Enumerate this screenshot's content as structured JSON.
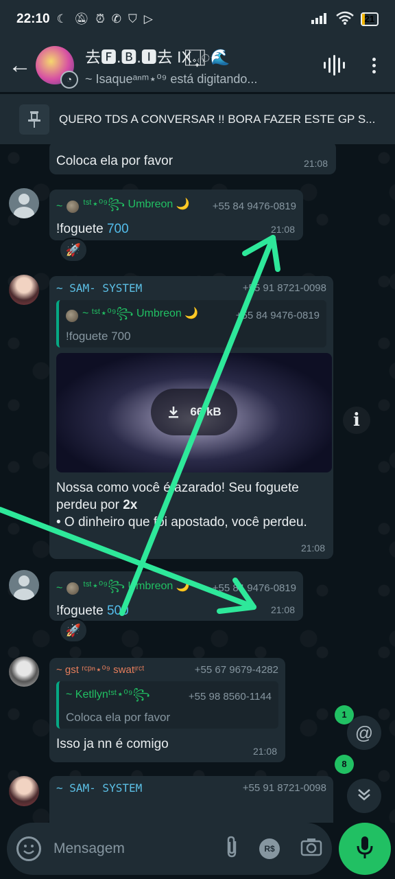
{
  "status_bar": {
    "time": "22:10",
    "icons": [
      "moon-icon",
      "bell-off-icon",
      "alarm-icon",
      "whatsapp-icon",
      "shield-icon",
      "play-icon"
    ],
    "battery": "21"
  },
  "header": {
    "title": "去🅵.🅱.🅸去 IX᩠𝆹⃞ ⃞᪾᮫🌊",
    "subtitle": "~ Isaqueᵃⁿᵐ⋆⁰⁹ está digitando..."
  },
  "pinned": {
    "text": "QUERO TDS A CONVERSAR !! BORA FAZER ESTE GP S..."
  },
  "messages": [
    {
      "text": "Coloca ela por favor",
      "time": "21:08"
    },
    {
      "sender_prefix": "~",
      "sender_name": "ᵗˢᵗ⋆⁰⁹꧂ Umbreon 🌙",
      "phone": "+55 84 9476-0819",
      "text_prefix": "!foguete ",
      "text_num": "700",
      "time": "21:08",
      "reaction": "🚀"
    },
    {
      "sender_name": "~ SAM- SYSTEM",
      "phone": "+55 91 8721-0098",
      "quote_name": "~ ᵗˢᵗ⋆⁰⁹꧂ Umbreon 🌙",
      "quote_phone": "+55 84 9476-0819",
      "quote_text": "!foguete 700",
      "media_size": "66 kB",
      "text_line1": "Nossa como você é azarado! Seu foguete",
      "text_line2_prefix": "perdeu por ",
      "text_line2_bold": "2x",
      "text_line3": "• O dinheiro que foi apostado, você perdeu.",
      "time": "21:08"
    },
    {
      "sender_prefix": "~",
      "sender_name": "ᵗˢᵗ⋆⁰⁹꧂ Umbreon 🌙",
      "phone": "+55 84 9476-0819",
      "text_prefix": "!foguete ",
      "text_num": "500",
      "time": "21:08",
      "reaction": "🚀"
    },
    {
      "sender_name": "~ gst ʳᶜᵖⁿ⋆⁰⁹ swatᵎʳᶜᵗ",
      "phone": "+55 67 9679-4282",
      "quote_name": "~ Ketllynᵗˢᵗ⋆⁰⁹꧂",
      "quote_phone": "+55 98 8560-1144",
      "quote_text": "Coloca ela por favor",
      "text": "Isso ja nn é comigo",
      "time": "21:08"
    },
    {
      "sender_name": "~ SAM- SYSTEM",
      "phone": "+55 91 8721-0098"
    }
  ],
  "floating": {
    "mention_badge": "1",
    "scroll_badge": "8"
  },
  "input": {
    "placeholder": "Mensagem",
    "pay_label": "R$"
  },
  "colors": {
    "accent": "#21c063",
    "annotation_arrows": "#2ee89a"
  }
}
